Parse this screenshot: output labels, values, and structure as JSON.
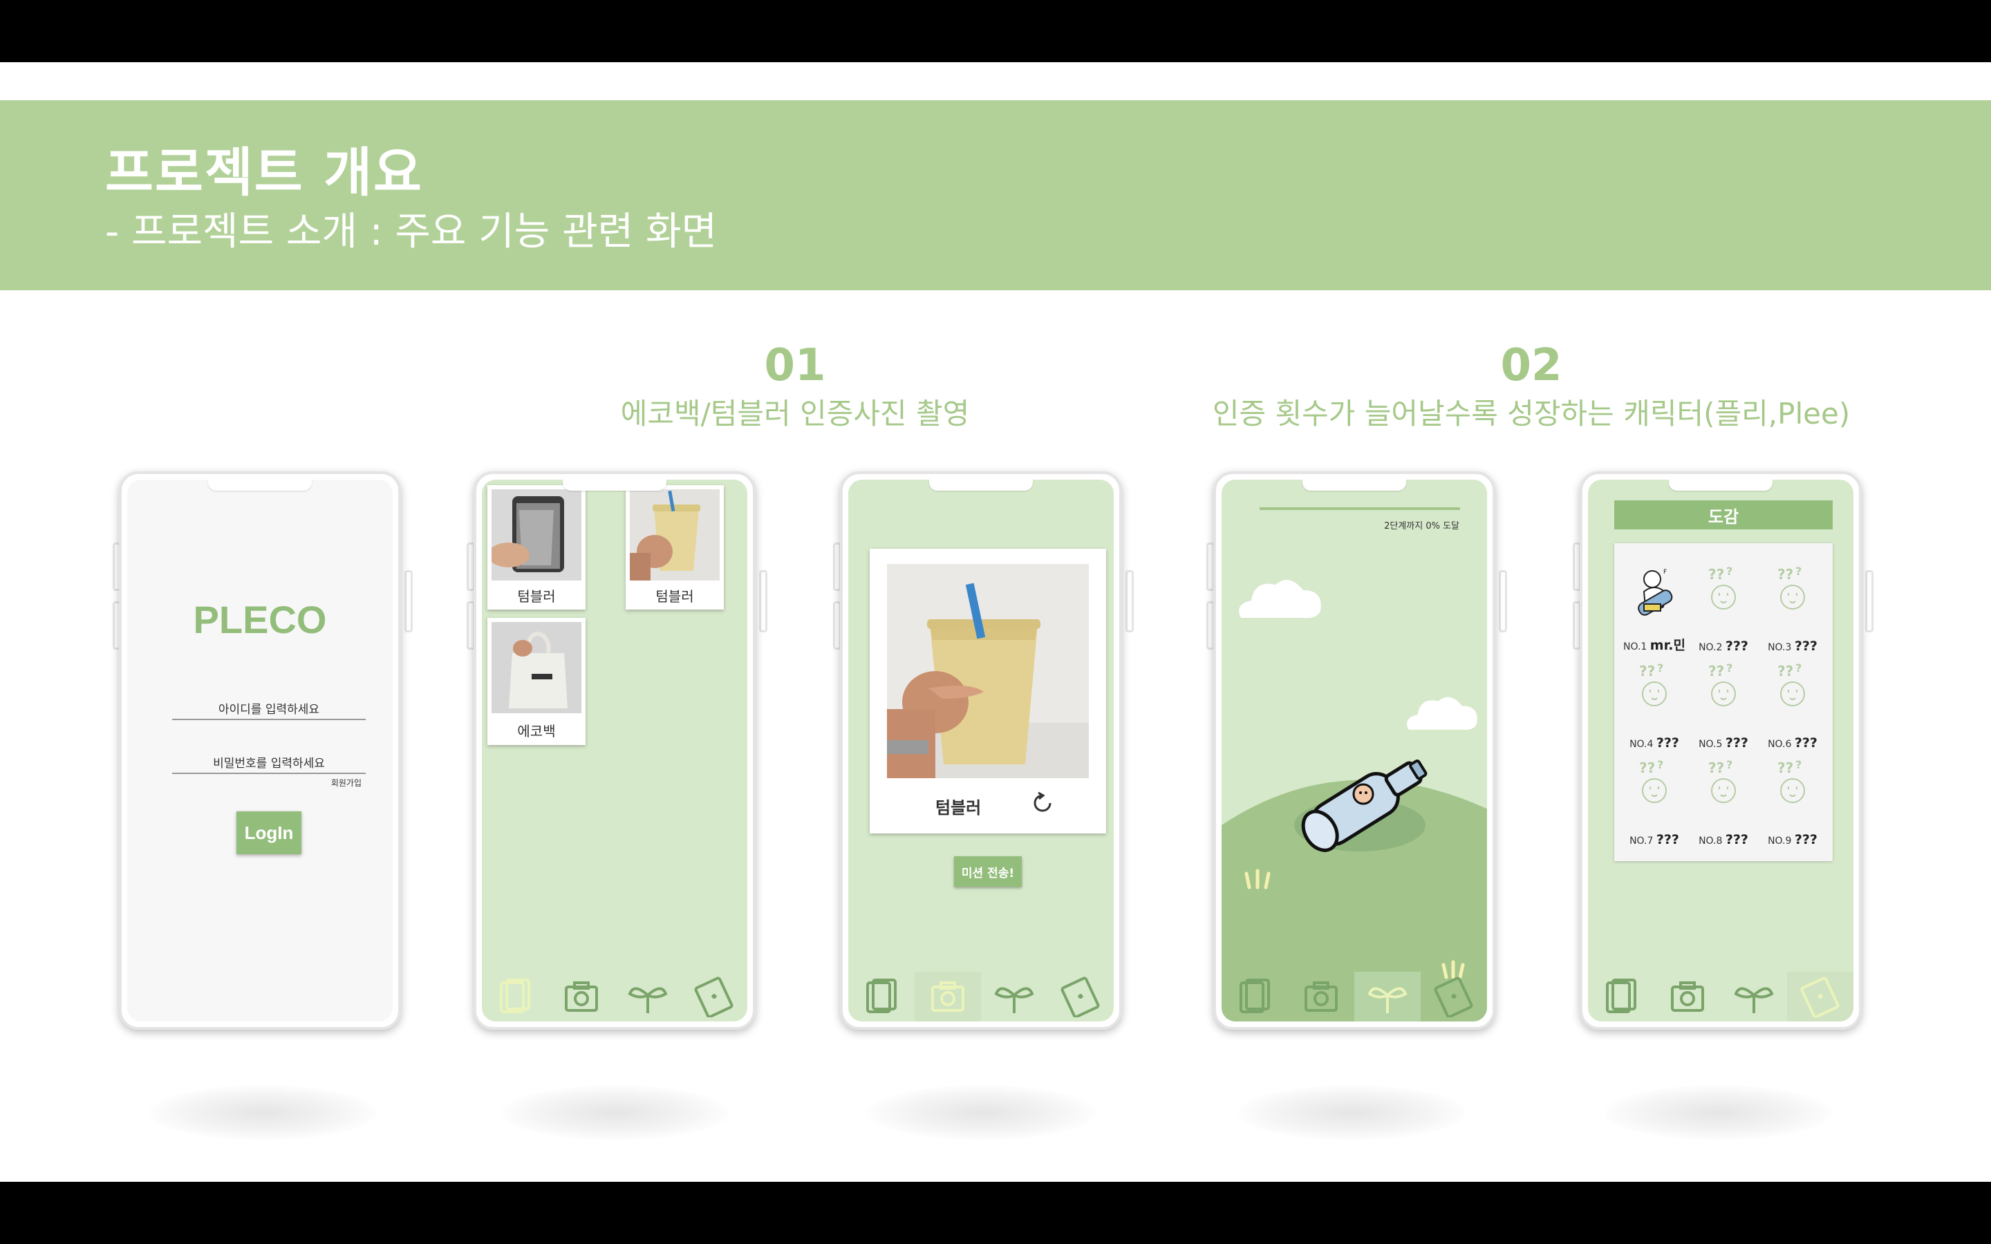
{
  "header": {
    "title": "프로젝트 개요",
    "subtitle": "- 프로젝트 소개 : 주요 기능 관련 화면"
  },
  "sections": [
    {
      "number": "01",
      "description": "에코백/텀블러 인증사진 촬영"
    },
    {
      "number": "02",
      "description": "인증 횟수가 늘어날수록 성장하는 캐릭터(플리,Plee)"
    }
  ],
  "login": {
    "logo": "PLECO",
    "id_placeholder": "아이디를 입력하세요",
    "pw_placeholder": "비밀번호를 입력하세요",
    "signup_link": "회원가입",
    "login_button": "LogIn"
  },
  "gallery": {
    "items": [
      {
        "label": "텀블러",
        "icon": "tumbler-photo"
      },
      {
        "label": "텀블러",
        "icon": "tumbler-photo"
      },
      {
        "label": "에코백",
        "icon": "ecobag-photo"
      }
    ]
  },
  "capture": {
    "label": "텀블러",
    "retake_icon": "refresh-icon",
    "submit_button": "미션 전송!"
  },
  "growth": {
    "progress_text": "2단계까지 0% 도달",
    "progress": 0
  },
  "dex": {
    "title": "도감",
    "entries": [
      {
        "no": "NO.1",
        "name": "mr.민"
      },
      {
        "no": "NO.2",
        "name": "???"
      },
      {
        "no": "NO.3",
        "name": "???"
      },
      {
        "no": "NO.4",
        "name": "???"
      },
      {
        "no": "NO.5",
        "name": "???"
      },
      {
        "no": "NO.6",
        "name": "???"
      },
      {
        "no": "NO.7",
        "name": "???"
      },
      {
        "no": "NO.8",
        "name": "???"
      },
      {
        "no": "NO.9",
        "name": "???"
      }
    ]
  },
  "nav": {
    "icons": [
      "gallery-icon",
      "camera-icon",
      "sprout-icon",
      "book-icon"
    ]
  },
  "colors": {
    "accent": "#b2d198",
    "screen_green": "#d7e9cb",
    "button_green": "#93bd7b",
    "hill": "#a3c58c",
    "text_green": "#a6c98a"
  }
}
